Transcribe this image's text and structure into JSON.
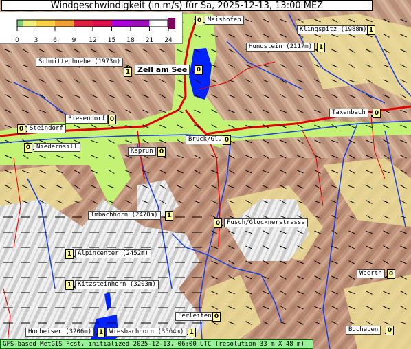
{
  "title": "Windgeschwindigkeit (in m/s) für Sa, 2025-12-13, 13:00 MEZ",
  "footer": "GFS-based MetGIS Fcst, initialized 2025-12-13, 06:00 UTC  (resolution 33 m X 48 m)",
  "legend": {
    "ticks": [
      "0",
      "3",
      "6",
      "9",
      "12",
      "15",
      "18",
      "21",
      "24"
    ],
    "colors": [
      "#80d080",
      "#f0f080",
      "#f8d040",
      "#f0a030",
      "#e02040",
      "#e01050",
      "#b000e0",
      "#a010c0",
      "#800060"
    ]
  },
  "colors": {
    "valley": "#c0f070",
    "lake": "#0020ff",
    "river": "#1040e0",
    "road": "#e00000",
    "snow": "#f4f4f4",
    "rock": "#c89880",
    "forest": "#d0a890"
  },
  "places": [
    {
      "name": "Maishofen",
      "value": "0"
    },
    {
      "name": "Klingspitz (1988m)",
      "value": "1"
    },
    {
      "name": "Hundstein (2117m)",
      "value": "1"
    },
    {
      "name": "Schmittenhoehe (1973m)",
      "value": "1"
    },
    {
      "name": "Zell am See",
      "value": "0"
    },
    {
      "name": "Taxenbach",
      "value": "0"
    },
    {
      "name": "Piesendorf",
      "value": "0"
    },
    {
      "name": "Steindorf",
      "value": "0"
    },
    {
      "name": "Bruck/Gl.",
      "value": "0"
    },
    {
      "name": "Niedernsill",
      "value": "0"
    },
    {
      "name": "Kaprun",
      "value": "0"
    },
    {
      "name": "Imbachhorn (2470m)",
      "value": "1"
    },
    {
      "name": "Fusch/Glocknerstrasse",
      "value": "0"
    },
    {
      "name": "Alpincenter (2452m)",
      "value": "1"
    },
    {
      "name": "Kitzsteinhorn (3203m)",
      "value": "1"
    },
    {
      "name": "Woerth",
      "value": "0"
    },
    {
      "name": "Ferleiten",
      "value": "0"
    },
    {
      "name": "Hocheiser (3206m)",
      "value": "1"
    },
    {
      "name": "Wiesbachhorn (3564m)",
      "value": "1"
    },
    {
      "name": "Bucheben",
      "value": "0"
    }
  ]
}
